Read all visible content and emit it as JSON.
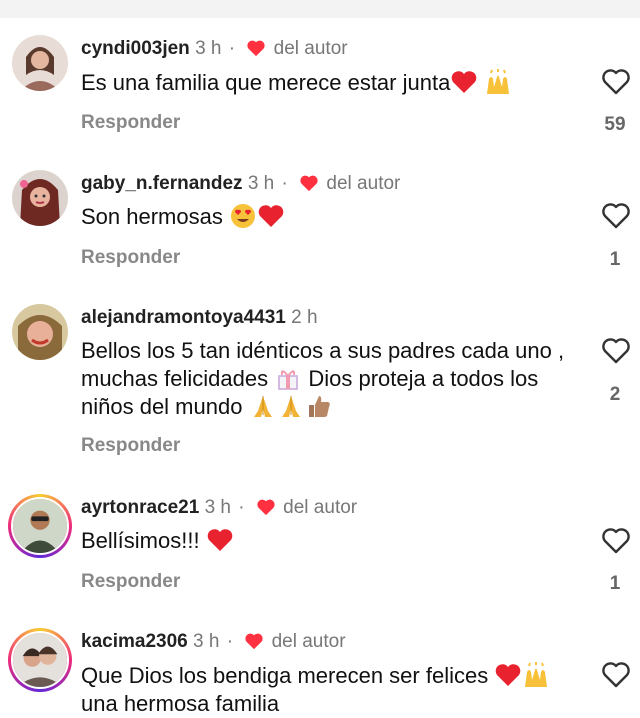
{
  "comments": [
    {
      "username": "cyndi003jen",
      "time": "3 h",
      "author_label": "del autor",
      "text": "Es una familia que merece estar junta",
      "reply_label": "Responder",
      "like_count": "59"
    },
    {
      "username": "gaby_n.fernandez",
      "time": "3 h",
      "author_label": "del autor",
      "text": "Son hermosas",
      "reply_label": "Responder",
      "like_count": "1"
    },
    {
      "username": "alejandramontoya4431",
      "time": "2 h",
      "text_part1": "Bellos los 5 tan idénticos a sus padres cada uno , muchas felicidades",
      "text_part2": "Dios proteja a todos los niños del mundo",
      "reply_label": "Responder",
      "like_count": "2"
    },
    {
      "username": "ayrtonrace21",
      "time": "3 h",
      "author_label": "del autor",
      "text": "Bellísimos!!!",
      "reply_label": "Responder",
      "like_count": "1"
    },
    {
      "username": "kacima2306",
      "time": "3 h",
      "author_label": "del autor",
      "text_part1": "Que Dios los bendiga merecen ser felices",
      "text_part2": "una hermosa familia"
    }
  ],
  "icons": {
    "like": "heart-outline-icon",
    "author_badge": "red-heart-icon",
    "accent": "#ff3040"
  },
  "separator": "·"
}
